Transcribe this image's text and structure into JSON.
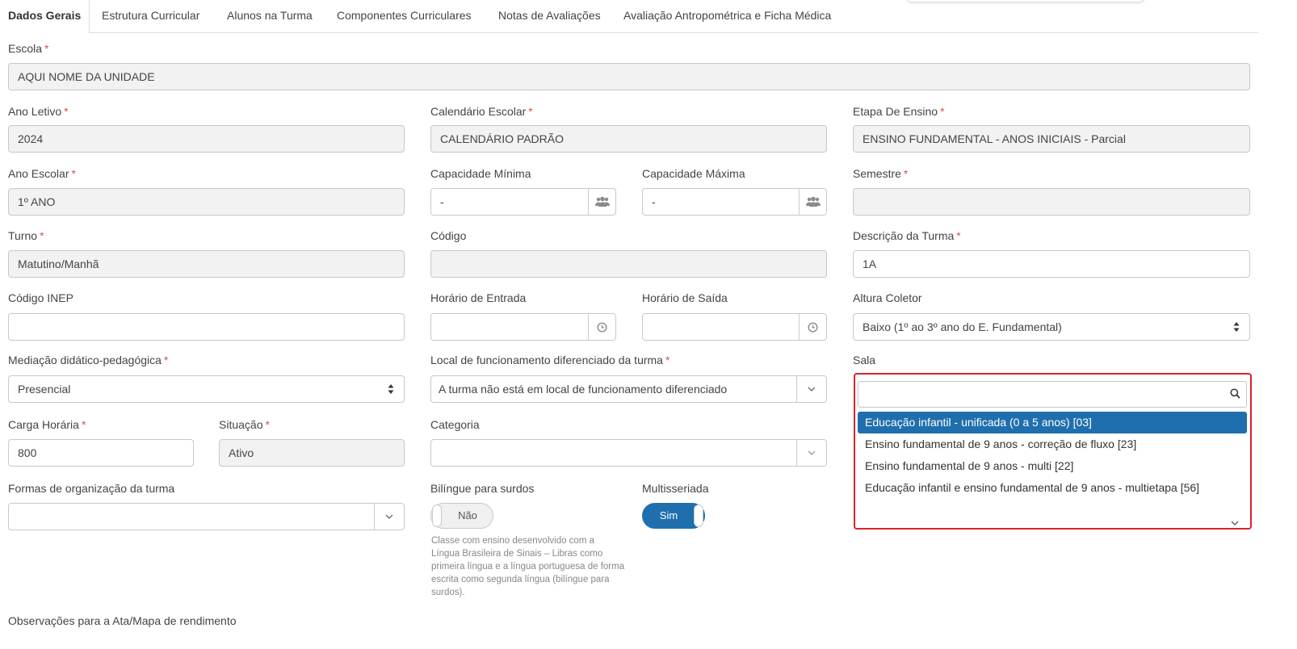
{
  "tabs": [
    "Dados Gerais",
    "Estrutura Curricular",
    "Alunos na Turma",
    "Componentes Curriculares",
    "Notas de Avaliações",
    "Avaliação Antropométrica e Ficha Médica"
  ],
  "required_mark": "*",
  "escola": {
    "label": "Escola",
    "value": "AQUI NOME DA UNIDADE"
  },
  "ano_letivo": {
    "label": "Ano Letivo",
    "value": "2024"
  },
  "calendario": {
    "label": "Calendário Escolar",
    "value": "CALENDÁRIO PADRÃO"
  },
  "etapa": {
    "label": "Etapa De Ensino",
    "value": "ENSINO FUNDAMENTAL - ANOS INICIAIS - Parcial"
  },
  "ano_escolar": {
    "label": "Ano Escolar",
    "value": "1º ANO"
  },
  "cap_min": {
    "label": "Capacidade Mínima",
    "value": "-"
  },
  "cap_max": {
    "label": "Capacidade Máxima",
    "value": "-"
  },
  "semestre": {
    "label": "Semestre",
    "value": ""
  },
  "turno": {
    "label": "Turno",
    "value": "Matutino/Manhã"
  },
  "codigo": {
    "label": "Código",
    "value": ""
  },
  "descricao": {
    "label": "Descrição da Turma",
    "value": "1A"
  },
  "inep": {
    "label": "Código INEP",
    "value": ""
  },
  "entrada": {
    "label": "Horário de Entrada",
    "value": ""
  },
  "saida": {
    "label": "Horário de Saída",
    "value": ""
  },
  "altura": {
    "label": "Altura Coletor",
    "value": "Baixo (1º ao 3º ano do E. Fundamental)"
  },
  "mediacao": {
    "label": "Mediação didático-pedagógica",
    "value": "Presencial"
  },
  "local": {
    "label": "Local de funcionamento diferenciado da turma",
    "value": "A turma não está em local de funcionamento diferenciado"
  },
  "sala": {
    "label": "Sala",
    "search_value": "",
    "options": [
      "Educação infantil - unificada (0 a 5 anos) [03]",
      "Ensino fundamental de 9 anos - correção de fluxo [23]",
      "Ensino fundamental de 9 anos - multi [22]",
      "Educação infantil e ensino fundamental de 9 anos - multietapa [56]"
    ],
    "highlighted_index": 0
  },
  "carga": {
    "label": "Carga Horária",
    "value": "800"
  },
  "situacao": {
    "label": "Situação",
    "value": "Ativo"
  },
  "categoria": {
    "label": "Categoria",
    "value": ""
  },
  "formas": {
    "label": "Formas de organização da turma",
    "value": ""
  },
  "bilingue": {
    "label": "Bilíngue para surdos",
    "state": "Não",
    "hint": "Classe com ensino desenvolvido com a Língua Brasileira de Sinais – Libras como primeira língua e a língua portuguesa de forma escrita como segunda língua (bilíngue para surdos)."
  },
  "multisseriada": {
    "label": "Multisseriada",
    "state": "Sim"
  },
  "observacoes": {
    "label": "Observações para a Ata/Mapa de rendimento"
  },
  "colors": {
    "primary": "#1f6fae",
    "required": "#d9534f",
    "focus_border": "#d9232a",
    "readonly_bg": "#f2f2f2"
  }
}
